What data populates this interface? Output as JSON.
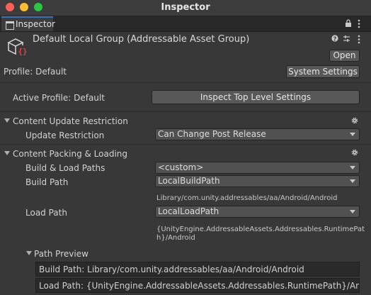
{
  "window": {
    "title": "Inspector"
  },
  "tab": {
    "label": "Inspector"
  },
  "header": {
    "title": "Default Local Group (Addressable Asset Group)",
    "open_label": "Open"
  },
  "profile": {
    "label": "Profile: Default",
    "system_settings_label": "System Settings",
    "active_profile_label": "Active Profile: Default",
    "inspect_label": "Inspect Top Level Settings"
  },
  "content_update": {
    "title": "Content Update Restriction",
    "update_restriction_label": "Update Restriction",
    "update_restriction_value": "Can Change Post Release"
  },
  "packing": {
    "title": "Content Packing & Loading",
    "build_load_paths_label": "Build & Load Paths",
    "build_load_paths_value": "<custom>",
    "build_path_label": "Build Path",
    "build_path_value": "LocalBuildPath",
    "build_path_resolved": "Library/com.unity.addressables/aa/Android/Android",
    "load_path_label": "Load Path",
    "load_path_value": "LocalLoadPath",
    "load_path_resolved_1": "{UnityEngine.AddressableAssets.Addressables.RuntimePat",
    "load_path_resolved_2": "h}/Android"
  },
  "path_preview": {
    "title": "Path Preview",
    "build_path": "Build Path: Library/com.unity.addressables/aa/Android/Android",
    "load_path": "Load Path: {UnityEngine.AddressableAssets.Addressables.RuntimePath}/Android"
  }
}
